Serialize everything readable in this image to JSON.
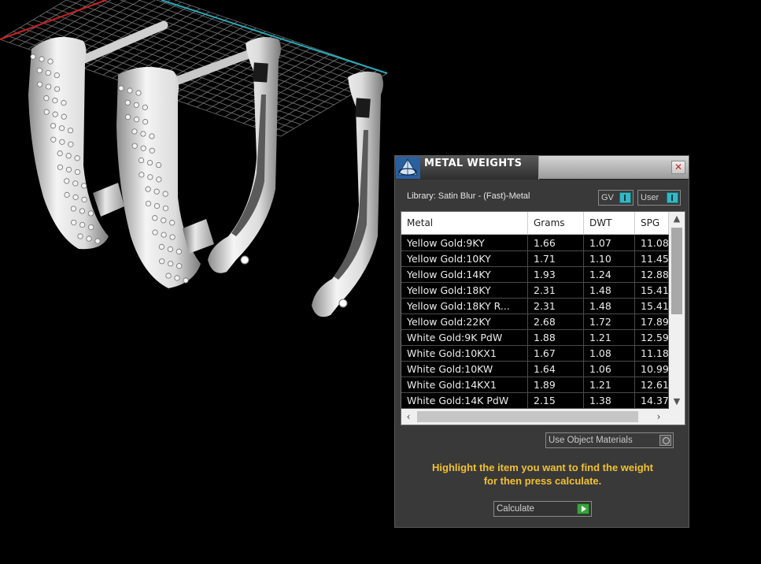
{
  "window": {
    "title": "METAL WEIGHTS",
    "close_glyph": "✕",
    "icon": "cad-app-icon"
  },
  "library": {
    "label": "Library: Satin Blur - (Fast)-Metal"
  },
  "toggles": {
    "gv": "GV",
    "user": "User"
  },
  "table": {
    "headers": [
      "Metal",
      "Grams",
      "DWT",
      "SPG"
    ],
    "rows": [
      [
        "Yellow Gold:9KY",
        "1.66",
        "1.07",
        "11.08"
      ],
      [
        "Yellow Gold:10KY",
        "1.71",
        "1.10",
        "11.45"
      ],
      [
        "Yellow Gold:14KY",
        "1.93",
        "1.24",
        "12.88"
      ],
      [
        "Yellow Gold:18KY",
        "2.31",
        "1.48",
        "15.41"
      ],
      [
        "Yellow Gold:18KY R...",
        "2.31",
        "1.48",
        "15.41"
      ],
      [
        "Yellow Gold:22KY",
        "2.68",
        "1.72",
        "17.89"
      ],
      [
        "White Gold:9K PdW",
        "1.88",
        "1.21",
        "12.59"
      ],
      [
        "White Gold:10KX1",
        "1.67",
        "1.08",
        "11.18"
      ],
      [
        "White Gold:10KW",
        "1.64",
        "1.06",
        "10.99"
      ],
      [
        "White Gold:14KX1",
        "1.89",
        "1.21",
        "12.61"
      ],
      [
        "White Gold:14K PdW",
        "2.15",
        "1.38",
        "14.37"
      ]
    ]
  },
  "use_object_materials": {
    "label": "Use Object Materials"
  },
  "hint": {
    "line1": "Highlight the item you want to find the weight",
    "line2": "for then press calculate."
  },
  "calculate": {
    "label": "Calculate"
  },
  "colors": {
    "panel_bg": "#393939",
    "hint_text": "#f2c12e",
    "toggle_accent": "#33b8c6",
    "go_button": "#3aa43a",
    "grid_line": "#8a8a8a",
    "axis_red": "#cc2020",
    "axis_cyan": "#2aa8b8"
  }
}
